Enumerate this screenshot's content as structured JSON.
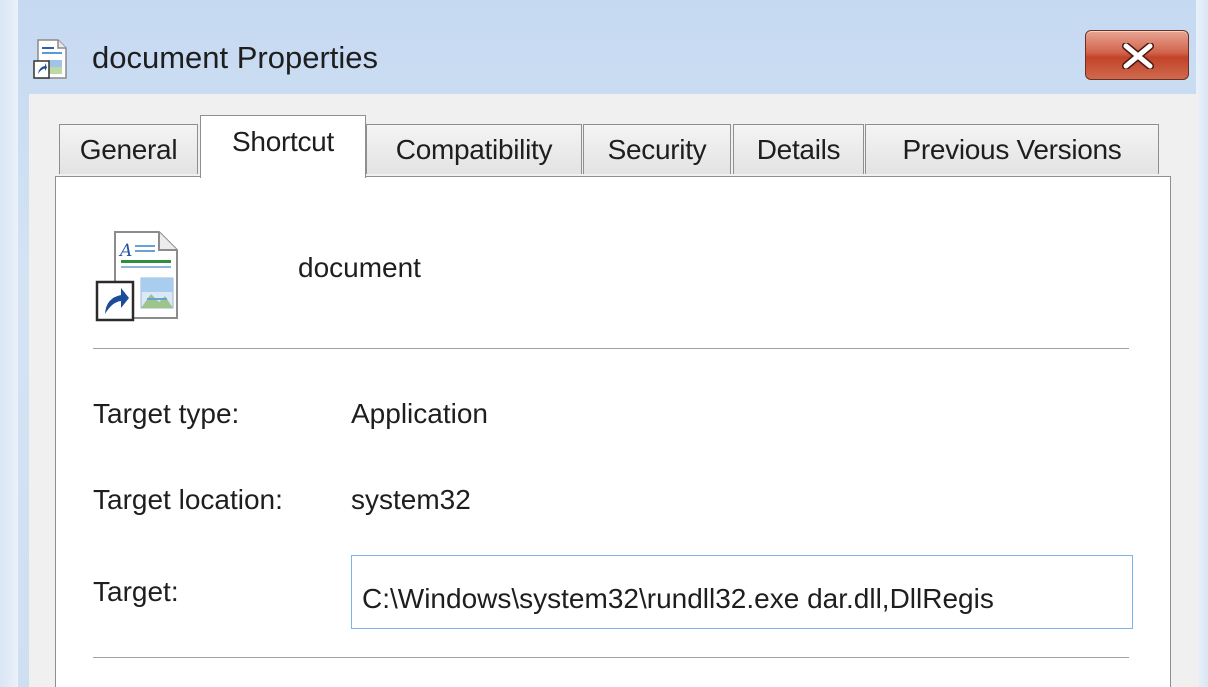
{
  "window": {
    "title": "document Properties",
    "accent": "#c2432a"
  },
  "tabs": [
    {
      "label": "General",
      "active": false
    },
    {
      "label": "Shortcut",
      "active": true
    },
    {
      "label": "Compatibility",
      "active": false
    },
    {
      "label": "Security",
      "active": false
    },
    {
      "label": "Details",
      "active": false
    },
    {
      "label": "Previous Versions",
      "active": false
    }
  ],
  "shortcut": {
    "file_name": "document",
    "target_type_label": "Target type:",
    "target_type_value": "Application",
    "target_location_label": "Target location:",
    "target_location_value": "system32",
    "target_label": "Target:",
    "target_value": "C:\\Windows\\system32\\rundll32.exe dar.dll,DllRegis"
  },
  "icons": {
    "title_icon": "shortcut-document-icon",
    "file_icon": "shortcut-document-icon",
    "close_icon": "close-icon"
  }
}
